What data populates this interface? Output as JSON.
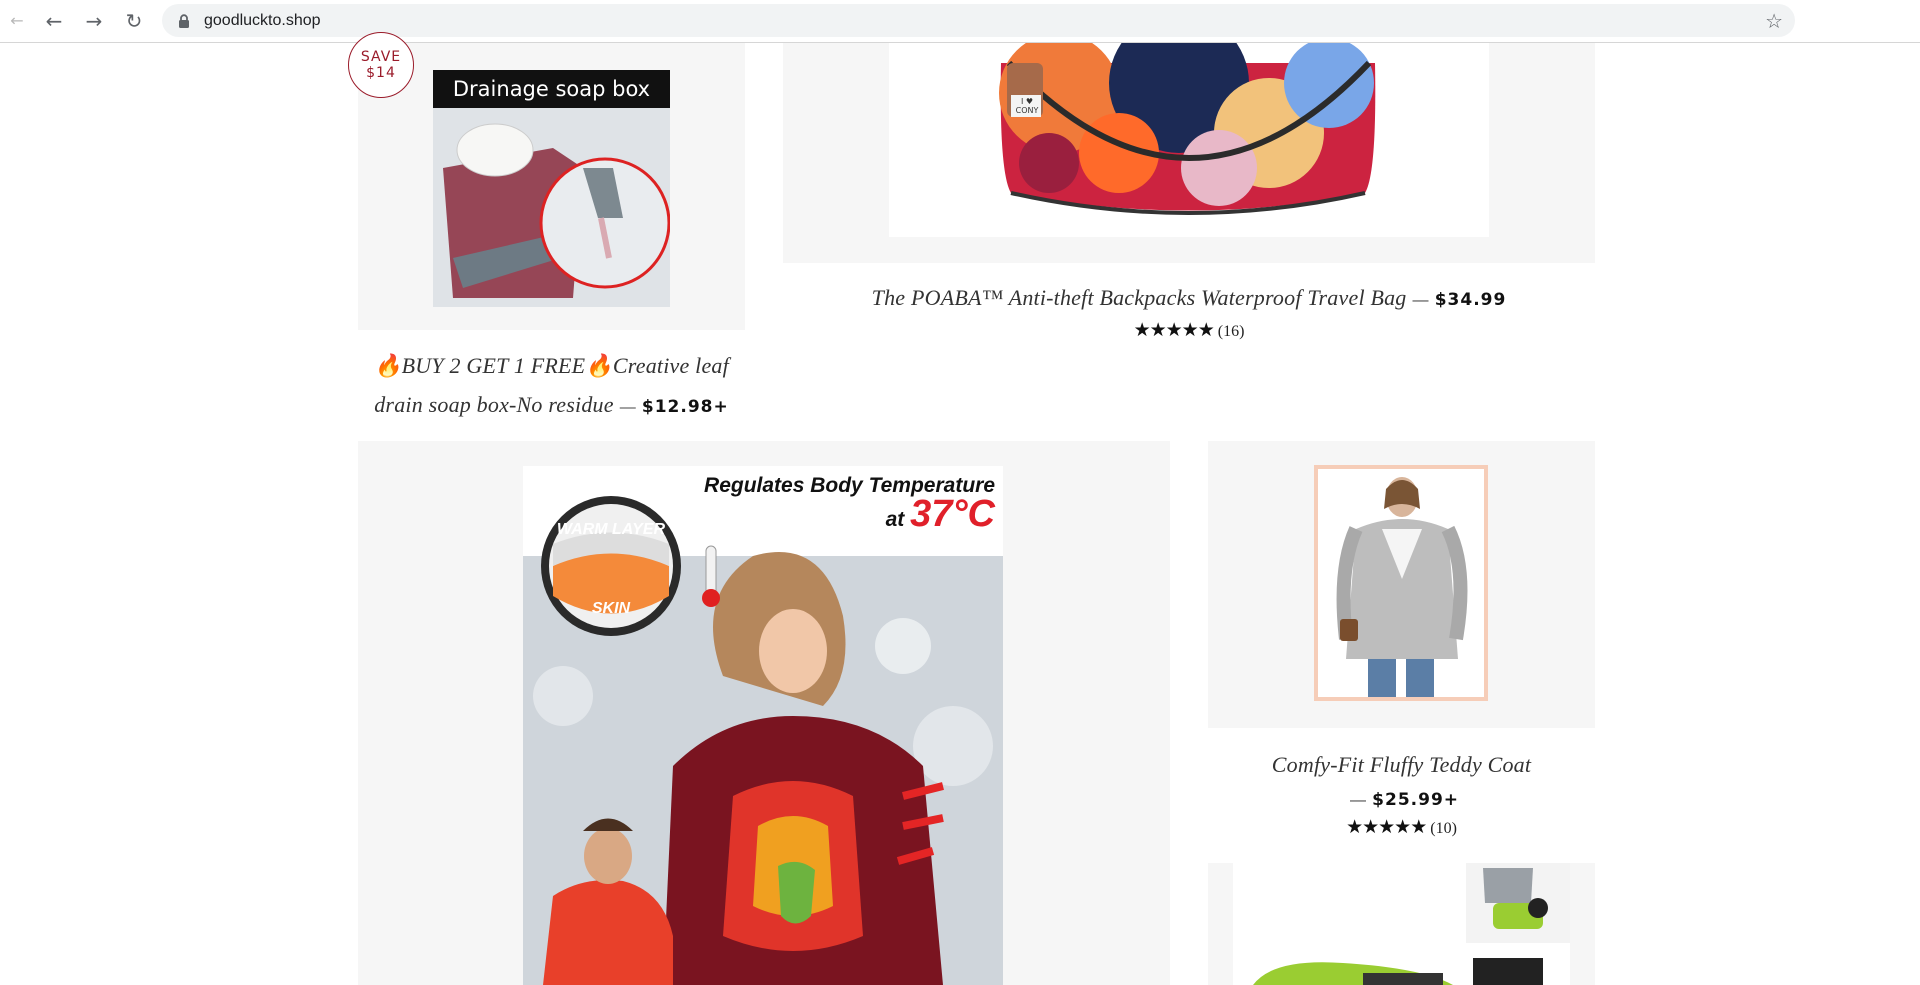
{
  "browser": {
    "url": "goodluckto.shop"
  },
  "products": {
    "soap": {
      "banner": "Drainage soap box",
      "badge_line1": "SAVE",
      "badge_line2": "$14",
      "title_line1": "BUY 2 GET 1 FREE",
      "title_mid": "Creative leaf",
      "title_line2": "drain soap box-No residue",
      "price": "$12.98+"
    },
    "backpack": {
      "title": "The POABA™ Anti-theft Backpacks Waterproof Travel Bag",
      "price": "$34.99",
      "stars": "★★★★★",
      "reviews": "(16)",
      "tag_line1": "I ♥",
      "tag_line2": "CONY"
    },
    "thermal": {
      "headline1": "Regulates Body Temperature",
      "headline2": "at",
      "temperature": "37°C",
      "warm_label": "WARM LAYER",
      "skin_label": "SKIN"
    },
    "coat": {
      "title": "Comfy-Fit Fluffy Teddy Coat",
      "price": "$25.99+",
      "stars": "★★★★★",
      "reviews": "(10)"
    }
  },
  "colors": {
    "accent": "#9a1b2a",
    "tile_bg": "#f6f6f6"
  }
}
